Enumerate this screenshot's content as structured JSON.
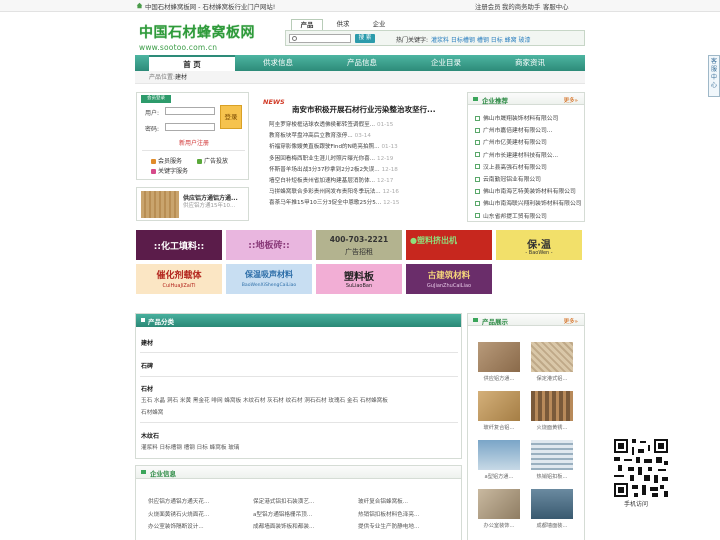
{
  "topbar": {
    "welcome": "中国石材蜂窝板网 - 石材蜂窝板行业门户网站!",
    "links": [
      "注册会员",
      "我的商务助手",
      "客服中心"
    ]
  },
  "logo": {
    "cn": "中国石材蜂窝板网",
    "en": "www.sootoo.com.cn"
  },
  "search": {
    "tabs": [
      "产品",
      "供求",
      "企业"
    ],
    "active": 0,
    "button": "搜 索",
    "hot_label": "热门关键字:",
    "hot_keywords": "灌浆料 日标槽钢 槽钢 日标 蜂窝 玻漆"
  },
  "nav": {
    "items": [
      "首 页",
      "供求信息",
      "产品信息",
      "企业目录",
      "商家资讯"
    ],
    "active": 0
  },
  "breadcrumb": {
    "label": "产品位置:",
    "current": "建材"
  },
  "login": {
    "badge": "会员登录",
    "user_label": "用户:",
    "pass_label": "密码:",
    "login_btn": "登录",
    "register": "新用户注册",
    "services": [
      "会员服务",
      "广告投放",
      "关键字服务"
    ]
  },
  "news": {
    "badge": "NEWS",
    "headline": "南安市积极开展石材行业污染整治攻坚行...",
    "items": [
      {
        "t": "阿圭罗穿梭框话球衣透佛侯都转签调假至...",
        "d": "01-15"
      },
      {
        "t": "教育板块苹盘冲高后立教育涨停...",
        "d": "03-14"
      },
      {
        "t": "祈福穿影像嫂美直板跟驶Find的N绝亮拍照...",
        "d": "01-13"
      },
      {
        "t": "多困回看梅西职业生涯儿时照片曝光你喜...",
        "d": "12-19"
      },
      {
        "t": "怀斯普羊场出战3分37秒拿到2分2板2失误...",
        "d": "12-18"
      },
      {
        "t": "墙空白补短板贵州省加速构建基层消防体...",
        "d": "12-17"
      },
      {
        "t": "马拼蜂窝联合多彩贵州网发布贵阳冬季玩法...",
        "d": "12-16"
      },
      {
        "t": "喜茶马年推15甲10三分3促全中恩歌25分5...",
        "d": "12-15"
      }
    ]
  },
  "recommend": {
    "title": "企业推荐",
    "more": "更多»",
    "items": [
      "佛山市晟翔装饰材料有限公司",
      "广州市嘉倍建材有限公司...",
      "广州市亿美建材有限公司",
      "广州市长建建材科技有限公...",
      "汉上县高强石材有限公司",
      "云南勤冠铝业有限公司",
      "佛山市南海艺特美装饰材料有限公司",
      "佛山市南海联兴翔利装饰材料有限公司",
      "山东省邦提工贸有限公司"
    ]
  },
  "product_card": {
    "name": "供应铝方通铝方通...",
    "sub": "供应铝方通15年10..."
  },
  "ads_row1": [
    {
      "text": "::化工填料::",
      "sub": ""
    },
    {
      "text": "::地板砖::",
      "sub": ""
    },
    {
      "text": "400-703-2221",
      "sub": "广告招租"
    },
    {
      "text": "●塑料挤出机",
      "sub": ""
    },
    {
      "text": "保·温",
      "sub": "- BaoWen -"
    }
  ],
  "ads_row2": [
    {
      "text": "催化剂载体",
      "sub": "CuiHuaJiZaiTi"
    },
    {
      "text": "保温吸声材料",
      "sub": "BaoWenXiShengCaiLiao"
    },
    {
      "text": "塑料板",
      "sub": "SuLiaoBan"
    },
    {
      "text": "古建筑材料",
      "sub": "GuJianZhuCaiLiao"
    }
  ],
  "category": {
    "title": "产品分类",
    "groups": [
      {
        "name": "建材",
        "items": ""
      },
      {
        "name": "石碑",
        "items": ""
      },
      {
        "name": "石材",
        "items": "玉石 水晶 洞石 米黄 黑金花 啡网 蜂窝板 木纹石材 灰石材 纹石材 洞石石材 玫瑰石 金石 石材蜂窝板"
      },
      {
        "name": "",
        "items": "石材蜂窝"
      },
      {
        "name": "木纹石",
        "items": "灌浆料 日标槽钢 槽钢 日标 蜂窝板 玻璃"
      }
    ]
  },
  "enterprise": {
    "title": "企业信息",
    "items": [
      "供应铝方通铝方通天花...",
      "保定港式铝扣石装潢艺...",
      "玻纤复合铝蜂窝板...",
      "火烧面黄锈石火烧面花...",
      "a型铝方通铝格栅吊顶...",
      "热销铝扣板材料色泽亮...",
      "办公室装饰隔断设计...",
      "成都墙面装饰板和都装...",
      "提供专业生产防静电地..."
    ]
  },
  "show": {
    "title": "产品展示",
    "more": "更多»",
    "items": [
      "供应铝方通...",
      "保定港式铝...",
      "玻纤复合铝...",
      "火烧面黄锈...",
      "a型铝方通...",
      "热销铝扣板...",
      "办公室装饰...",
      "成都墙面装..."
    ]
  },
  "side": {
    "text": "客服中心"
  },
  "qr": {
    "label": "手机访问"
  },
  "colors": {
    "nav": "#2d8b79",
    "green": "#2e9a3a"
  }
}
